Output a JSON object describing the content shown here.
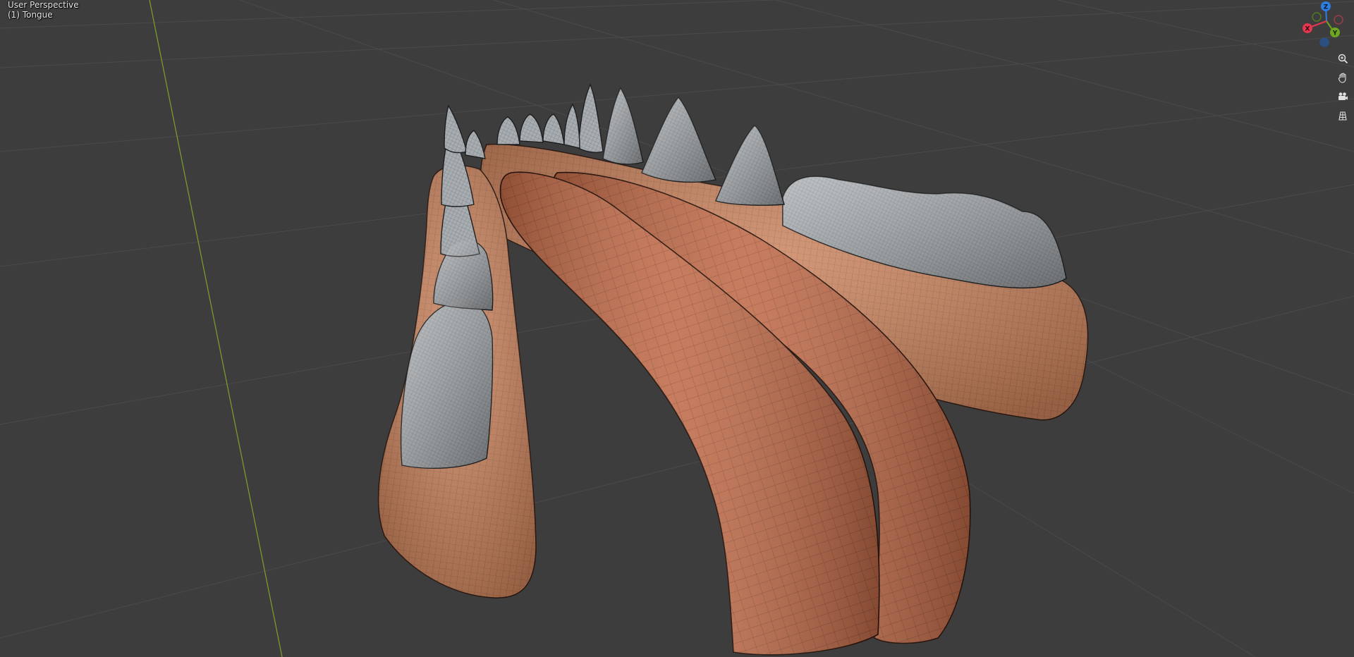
{
  "viewport": {
    "view_name": "User Perspective",
    "active_object": "(1) Tongue",
    "background_color": "#3d3d3d",
    "grid_line_color": "#4a4a4a",
    "y_axis_color": "#7a9a2a"
  },
  "gizmo": {
    "axes": [
      {
        "label": "Z",
        "color": "#2f7de1",
        "name": "z-axis"
      },
      {
        "label": "Y",
        "color": "#6ea61f",
        "name": "y-axis"
      },
      {
        "label": "X",
        "color": "#e5374f",
        "name": "x-axis"
      }
    ]
  },
  "nav_tools": [
    {
      "name": "zoom-icon",
      "title": "Zoom"
    },
    {
      "name": "hand-icon",
      "title": "Move"
    },
    {
      "name": "camera-icon",
      "title": "Camera view"
    },
    {
      "name": "grid-icon",
      "title": "Orthographic toggle"
    }
  ],
  "model": {
    "gum_color": "#c8805a",
    "tongue_color": "#c06a48",
    "tooth_color": "#a9aeb2"
  }
}
